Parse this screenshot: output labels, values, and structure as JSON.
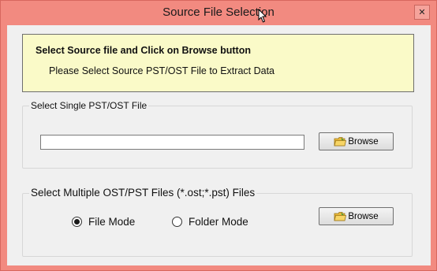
{
  "window": {
    "title": "Source File Selection",
    "close_symbol": "✕",
    "frame_color": "#f28a80"
  },
  "info": {
    "heading": "Select Source file and Click on Browse button",
    "subtext": "Please Select Source PST/OST File to Extract Data",
    "background": "#fafac8"
  },
  "single": {
    "legend": "Select Single PST/OST File",
    "path_value": "",
    "browse_label": "Browse",
    "browse_icon": "folder-icon"
  },
  "multiple": {
    "legend": "Select Multiple OST/PST Files (*.ost;*.pst) Files",
    "options": [
      {
        "label": "File Mode",
        "selected": true
      },
      {
        "label": "Folder Mode",
        "selected": false
      }
    ],
    "browse_label": "Browse",
    "browse_icon": "folder-icon"
  }
}
